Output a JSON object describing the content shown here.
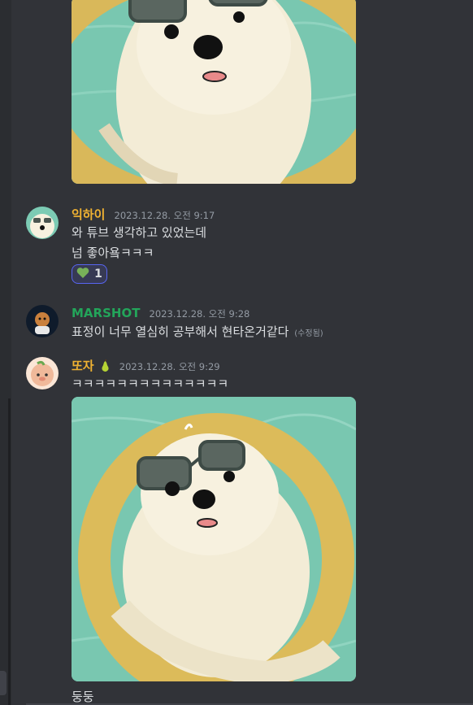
{
  "colors": {
    "username_ikhai": "#f0b232",
    "username_marshot": "#23a55a",
    "username_ttoja": "#f0b232",
    "reaction_border": "#5865f2",
    "timestamp": "#949ba4"
  },
  "messages": [
    {
      "username": "익하이",
      "timestamp": "2023.12.28. 오전 9:17",
      "lines": [
        "와 튜브 생각하고 있었는데",
        "넘 좋아욬ㅋㅋㅋ"
      ],
      "reaction": {
        "emoji": "green-heart",
        "count": "1"
      }
    },
    {
      "username": "MARSHOT",
      "timestamp": "2023.12.28. 오전 9:28",
      "lines": [
        "표정이 너무 열심히 공부해서 현타온거같다"
      ],
      "edited_label": "(수정됨)"
    },
    {
      "username": "또자",
      "badge_icon": "pear-icon",
      "timestamp": "2023.12.28. 오전 9:29",
      "lines": [
        "ㅋㅋㅋㅋㅋㅋㅋㅋㅋㅋㅋㅋㅋㅋ"
      ],
      "caption": "둥둥"
    }
  ]
}
